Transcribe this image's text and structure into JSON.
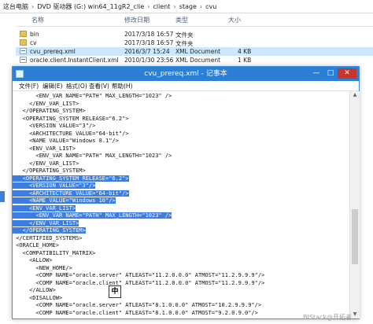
{
  "explorer": {
    "breadcrumb": [
      "这台电脑",
      "DVD 驱动器 (G:) win64_11gR2_clie",
      "client",
      "stage",
      "cvu"
    ],
    "breadcrumb_sep": "›",
    "columns": {
      "name": "名称",
      "date": "修改日期",
      "type": "类型",
      "size": "大小"
    },
    "files": [
      {
        "name": "bin",
        "date": "2017/3/18 16:57",
        "type": "文件夹",
        "size": "",
        "icon": "folder-icon",
        "selected": false
      },
      {
        "name": "cv",
        "date": "2017/3/18 16:57",
        "type": "文件夹",
        "size": "",
        "icon": "folder-icon",
        "selected": false
      },
      {
        "name": "cvu_prereq.xml",
        "date": "2016/3/7 15:24",
        "type": "XML Document",
        "size": "4 KB",
        "icon": "xml-file-icon",
        "selected": true
      },
      {
        "name": "oracle.client.InstantClient.xml",
        "date": "2010/1/30 23:56",
        "type": "XML Document",
        "size": "1 KB",
        "icon": "xml-file-icon",
        "selected": false
      }
    ]
  },
  "notepad": {
    "title": "cvu_prereq.xml - 记事本",
    "buttons": {
      "minimize": "—",
      "maximize": "□",
      "close": "✕"
    },
    "menu": [
      "文件(F)",
      "编辑(E)",
      "格式(O)",
      "查看(V)",
      "帮助(H)"
    ],
    "lines": [
      {
        "text": "       <ENV_VAR NAME=\"PATH\" MAX_LENGTH=\"1023\" />",
        "sel": false
      },
      {
        "text": "     </ENV_VAR_LIST>",
        "sel": false
      },
      {
        "text": "   </OPERATING_SYSTEM>",
        "sel": false
      },
      {
        "text": "   <OPERATING_SYSTEM RELEASE=\"6.2\">",
        "sel": false
      },
      {
        "text": "     <VERSION VALUE=\"3\"/>",
        "sel": false
      },
      {
        "text": "     <ARCHITECTURE VALUE=\"64-bit\"/>",
        "sel": false
      },
      {
        "text": "     <NAME VALUE=\"Windows 8.1\"/>",
        "sel": false
      },
      {
        "text": "     <ENV_VAR_LIST>",
        "sel": false
      },
      {
        "text": "       <ENV_VAR NAME=\"PATH\" MAX_LENGTH=\"1023\" />",
        "sel": false
      },
      {
        "text": "     </ENV_VAR_LIST>",
        "sel": false
      },
      {
        "text": "   </OPERATING_SYSTEM>",
        "sel": false
      },
      {
        "text": "   <OPERATING_SYSTEM RELEASE=\"6.2\">",
        "sel": true
      },
      {
        "text": "     <VERSION VALUE=\"3\"/>",
        "sel": true
      },
      {
        "text": "     <ARCHITECTURE VALUE=\"64-bit\"/>",
        "sel": true
      },
      {
        "text": "     <NAME VALUE=\"Windows 10\"/>",
        "sel": true
      },
      {
        "text": "     <ENV_VAR_LIST>",
        "sel": true
      },
      {
        "text": "       <ENV_VAR NAME=\"PATH\" MAX_LENGTH=\"1023\" />",
        "sel": true
      },
      {
        "text": "     </ENV_VAR_LIST>",
        "sel": true
      },
      {
        "text": "   </OPERATING_SYSTEM>",
        "sel": true
      },
      {
        "text": " </CERTIFIED_SYSTEMS>",
        "sel": false
      },
      {
        "text": " <ORACLE_HOME>",
        "sel": false
      },
      {
        "text": "   <COMPATIBILITY_MATRIX>",
        "sel": false
      },
      {
        "text": "     <ALLOW>",
        "sel": false
      },
      {
        "text": "       <NEW_HOME/>",
        "sel": false
      },
      {
        "text": "       <COMP NAME=\"oracle.server\" ATLEAST=\"11.2.0.0.0\" ATMOST=\"11.2.9.9.9\"/>",
        "sel": false
      },
      {
        "text": "       <COMP NAME=\"oracle.client\" ATLEAST=\"11.2.0.0.0\" ATMOST=\"11.2.9.9.9\"/>",
        "sel": false
      },
      {
        "text": "     </ALLOW>",
        "sel": false
      },
      {
        "text": "     <DISALLOW>",
        "sel": false
      },
      {
        "text": "       <COMP NAME=\"oracle.server\" ATLEAST=\"8.1.0.0.0\" ATMOST=\"10.2.9.9.9\"/>",
        "sel": false
      },
      {
        "text": "       <COMP NAME=\"oracle.client\" ATLEAST=\"8.1.0.0.0\" ATMOST=\"9.2.0.9.0\"/>",
        "sel": false
      }
    ],
    "ime_indicator": "中",
    "scroll_up": "▲",
    "scroll_down": "▼"
  },
  "watermark": "BIStack@开拓者"
}
